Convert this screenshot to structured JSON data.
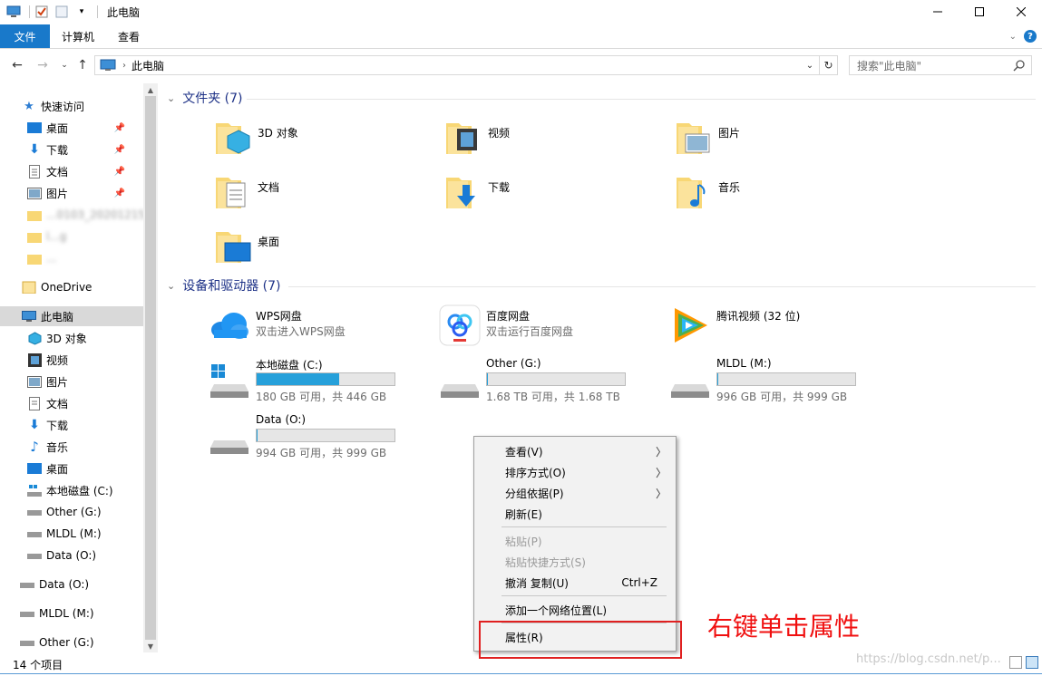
{
  "window": {
    "title": "此电脑",
    "controls": [
      "minimize-icon",
      "maximize-icon",
      "close-icon"
    ]
  },
  "ribbon": {
    "tabs": [
      "文件",
      "计算机",
      "查看"
    ]
  },
  "address": {
    "path": "此电脑",
    "search_placeholder": "搜索\"此电脑\""
  },
  "nav": {
    "quick_access": "快速访问",
    "quick_items": [
      "桌面",
      "下载",
      "文档",
      "图片"
    ],
    "blurred_items": [
      "...0103_20201215",
      "l...g",
      "..."
    ],
    "onedrive": "OneDrive",
    "this_pc": "此电脑",
    "pc_items": [
      "3D 对象",
      "视频",
      "图片",
      "文档",
      "下载",
      "音乐",
      "桌面",
      "本地磁盘 (C:)",
      "Other (G:)",
      "MLDL (M:)",
      "Data (O:)"
    ],
    "drives": [
      "Data (O:)",
      "MLDL (M:)",
      "Other (G:)"
    ]
  },
  "content": {
    "folders_header": "文件夹 (7)",
    "folders": [
      "3D 对象",
      "视频",
      "图片",
      "文档",
      "下载",
      "音乐",
      "桌面"
    ],
    "devices_header": "设备和驱动器 (7)",
    "apps": [
      {
        "name": "WPS网盘",
        "sub": "双击进入WPS网盘"
      },
      {
        "name": "百度网盘",
        "sub": "双击运行百度网盘"
      },
      {
        "name": "腾讯视频 (32 位)",
        "sub": ""
      }
    ],
    "drives": [
      {
        "name": "本地磁盘 (C:)",
        "info": "180 GB 可用，共 446 GB",
        "used": 0.6
      },
      {
        "name": "Other (G:)",
        "info": "1.68 TB 可用，共 1.68 TB",
        "used": 0.0
      },
      {
        "name": "MLDL (M:)",
        "info": "996 GB 可用，共 999 GB",
        "used": 0.003
      },
      {
        "name": "Data (O:)",
        "info": "994 GB 可用，共 999 GB",
        "used": 0.005
      }
    ]
  },
  "context_menu": {
    "view": "查看(V)",
    "sort": "排序方式(O)",
    "group": "分组依据(P)",
    "refresh": "刷新(E)",
    "paste": "粘贴(P)",
    "paste_shortcut": "粘贴快捷方式(S)",
    "undo_copy": "撤消 复制(U)",
    "undo_shortcut": "Ctrl+Z",
    "add_network": "添加一个网络位置(L)",
    "properties": "属性(R)"
  },
  "status": {
    "count": "14 个项目"
  },
  "annotation": {
    "text": "右键单击属性"
  },
  "watermark": "https://blog.csdn.net/p..."
}
